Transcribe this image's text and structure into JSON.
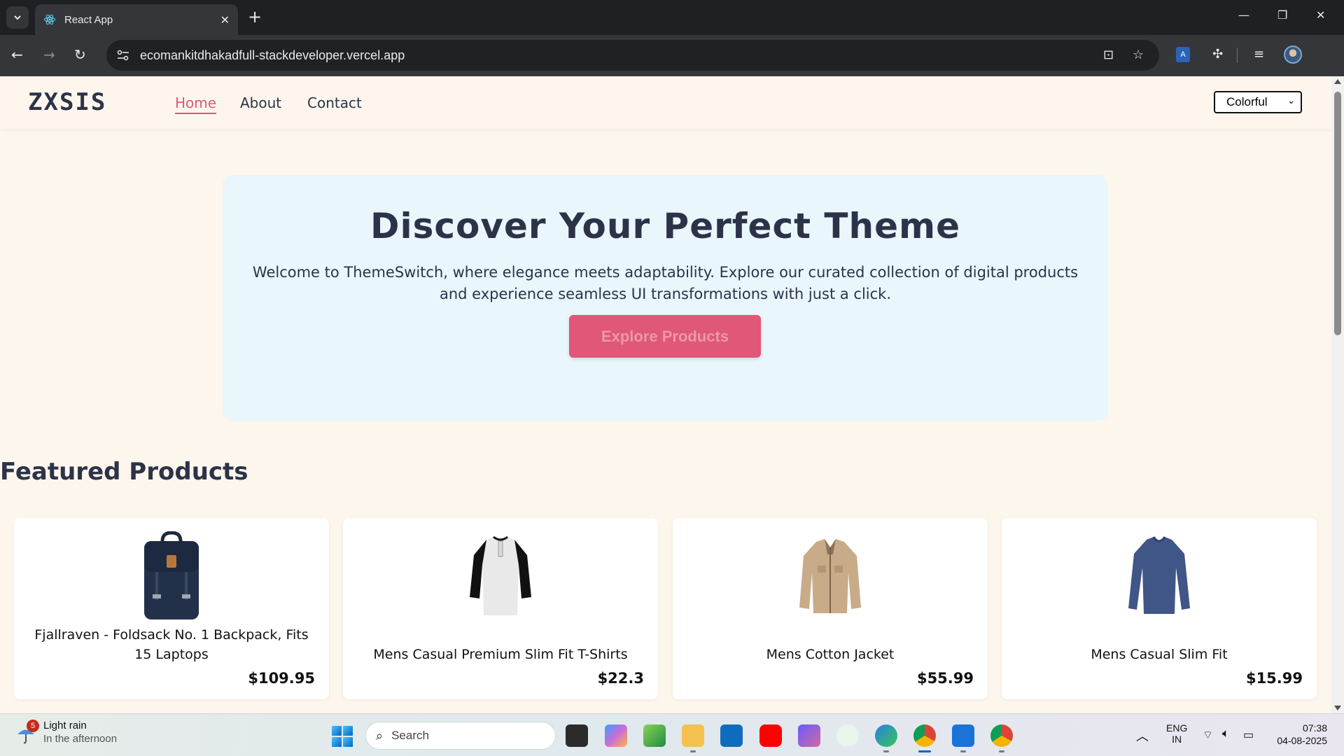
{
  "browser": {
    "tab_title": "React App",
    "url": "ecomankitdhakadfull-stackdeveloper.vercel.app"
  },
  "site": {
    "logo": "ZXSIS",
    "nav": [
      {
        "label": "Home",
        "active": true
      },
      {
        "label": "About",
        "active": false
      },
      {
        "label": "Contact",
        "active": false
      }
    ],
    "theme_select": {
      "value": "Colorful"
    },
    "accent_color": "#e05777",
    "hero_bg_color": "#e9f6fc",
    "page_bg_color": "#fdf6ec"
  },
  "hero": {
    "title": "Discover Your Perfect Theme",
    "text": "Welcome to ThemeSwitch, where elegance meets adaptability. Explore our curated collection of digital products and experience seamless UI transformations with just a click.",
    "cta": "Explore Products"
  },
  "featured": {
    "title": "Featured Products",
    "products": [
      {
        "title": "Fjallraven - Foldsack No. 1 Backpack, Fits 15 Laptops",
        "price": "$109.95",
        "icon": "backpack-image"
      },
      {
        "title": "Mens Casual Premium Slim Fit T-Shirts",
        "price": "$22.3",
        "icon": "tshirt-image"
      },
      {
        "title": "Mens Cotton Jacket",
        "price": "$55.99",
        "icon": "jacket-image"
      },
      {
        "title": "Mens Casual Slim Fit",
        "price": "$15.99",
        "icon": "longsleeve-image"
      }
    ]
  },
  "taskbar": {
    "weather": {
      "badge": "5",
      "condition": "Light rain",
      "detail": "In the afternoon"
    },
    "search_placeholder": "Search",
    "language": {
      "line1": "ENG",
      "line2": "IN"
    },
    "time": "07:38",
    "date": "04-08-2025"
  }
}
